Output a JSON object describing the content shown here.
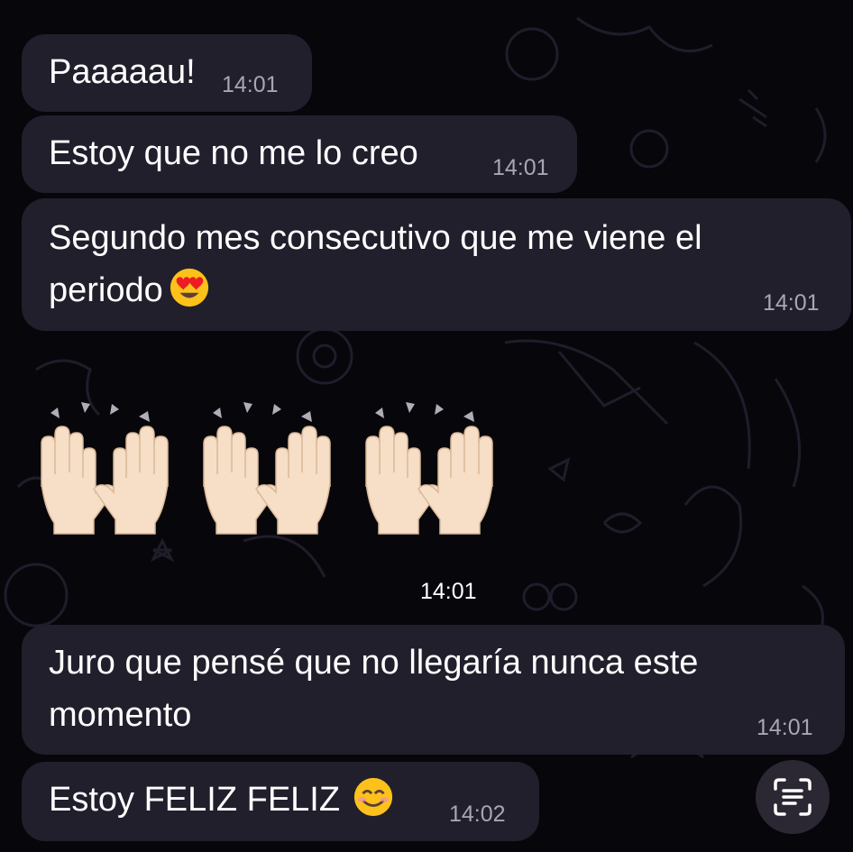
{
  "messages": [
    {
      "text": "Paaaaau!",
      "time": "14:01"
    },
    {
      "text": "Estoy que no me lo creo",
      "time": "14:01"
    },
    {
      "line1": "Segundo mes consecutivo que me viene el",
      "line2": "periodo",
      "emoji": "heart-eyes-emoji",
      "time": "14:01"
    },
    {
      "type": "emoji-only",
      "emoji": "raised-hands-emoji",
      "count": 3,
      "time": "14:01"
    },
    {
      "line1": "Juro que pensé que no llegaría nunca este",
      "line2": "momento",
      "time": "14:01"
    },
    {
      "text": "Estoy FELIZ FELIZ",
      "emoji": "smiling-face-emoji",
      "time": "14:02"
    }
  ],
  "overlay": {
    "icon": "text-scan-icon"
  },
  "colors": {
    "background": "#07060b",
    "bubble": "#221f2c",
    "text": "#ffffff",
    "timestamp": "#a9a5b5",
    "doodle": "#1f1d2a"
  }
}
